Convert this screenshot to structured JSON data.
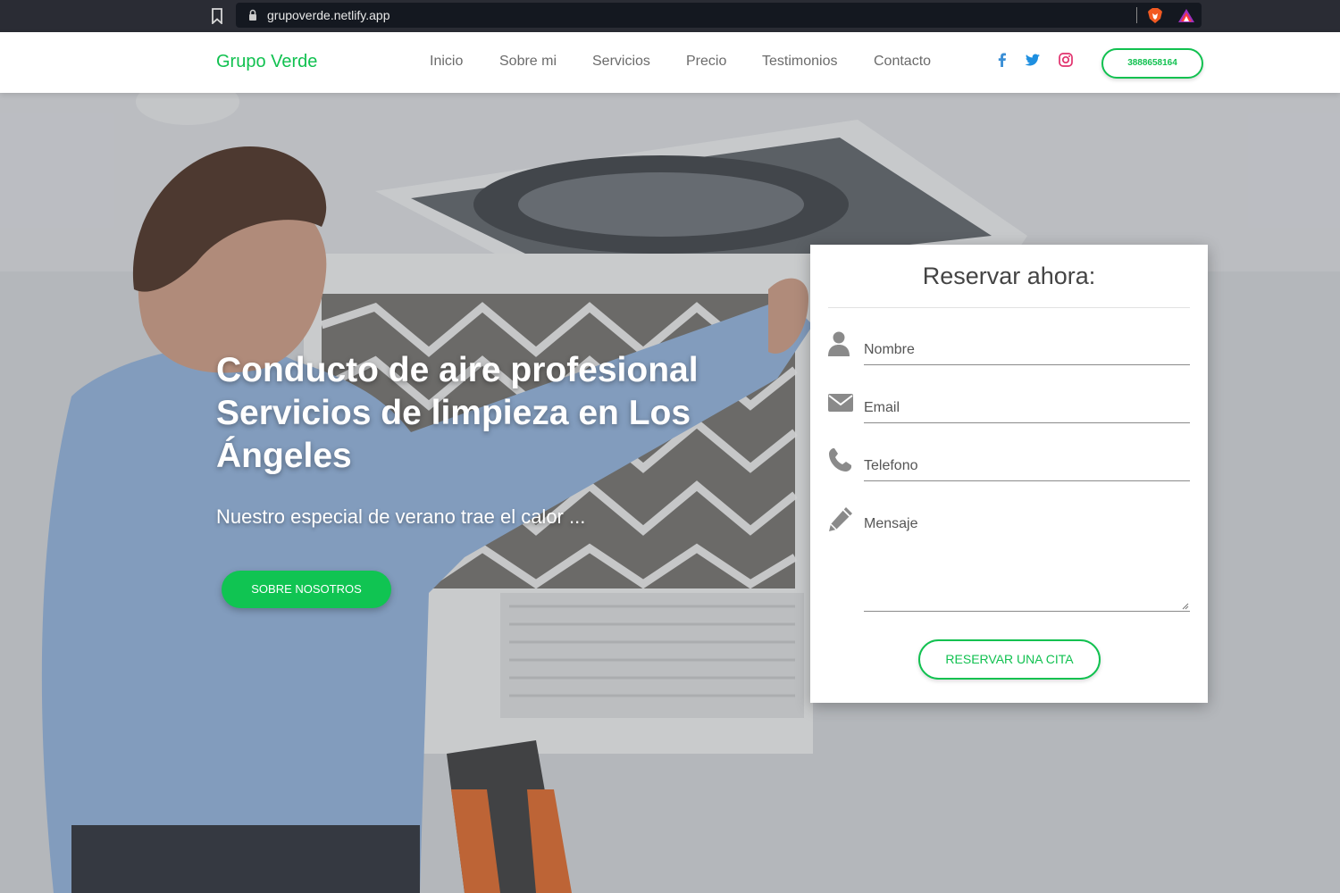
{
  "browser": {
    "url": "grupoverde.netlify.app"
  },
  "navbar": {
    "brand": "Grupo Verde",
    "links": [
      "Inicio",
      "Sobre mi",
      "Servicios",
      "Precio",
      "Testimonios",
      "Contacto"
    ],
    "social_icons": [
      "facebook-icon",
      "twitter-icon",
      "instagram-icon"
    ],
    "phone": "3888658164"
  },
  "hero": {
    "title": "Conducto de aire profesional Servicios de limpieza en Los Ángeles",
    "subtitle": "Nuestro especial de verano trae el calor ...",
    "button": "SOBRE NOSOTROS"
  },
  "form": {
    "title": "Reservar ahora:",
    "fields": {
      "name": "Nombre",
      "email": "Email",
      "phone": "Telefono",
      "message": "Mensaje"
    },
    "submit": "RESERVAR UNA CITA"
  },
  "colors": {
    "accent": "#11c150",
    "facebook": "#3b5998",
    "twitter": "#1da1f2",
    "instagram": "#e1306c"
  }
}
